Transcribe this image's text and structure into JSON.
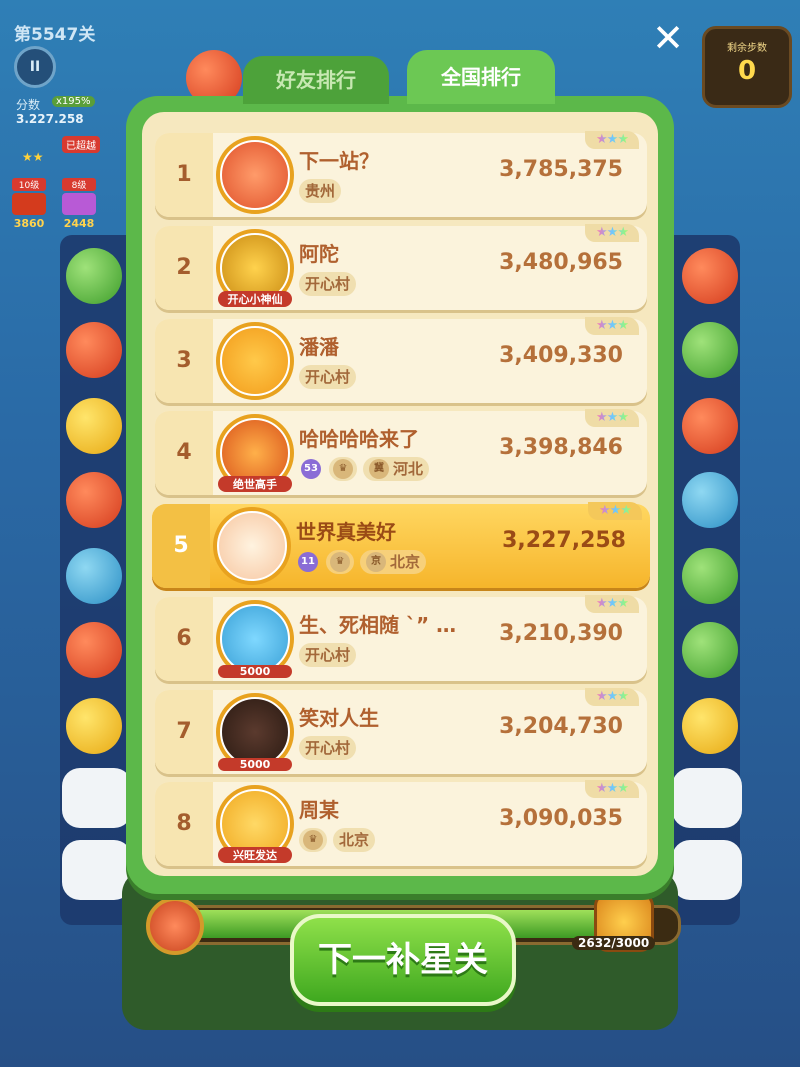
{
  "hud": {
    "level": "第5547关",
    "pause_icon": "pause-icon",
    "score_label": "分数",
    "score_multiplier": "x195%",
    "score_value": "3.227.258",
    "stars": "★★",
    "passed_badge": "已超越",
    "box1_label": "10级",
    "box1_value": "3860",
    "box2_label": "8级",
    "box2_value": "2448",
    "close_icon": "close-icon",
    "steps_label": "剩余步数",
    "steps_value": "0",
    "progress_value": "2632/3000",
    "progress_fraction": 0.877
  },
  "tabs": {
    "friends": "好友排行",
    "national": "全国排行"
  },
  "leaderboard": [
    {
      "rank": "1",
      "name": "下一站？",
      "tags": [
        "贵州"
      ],
      "score": "3,785,375",
      "stars": "★★★",
      "avatar": "fox-avatar"
    },
    {
      "rank": "2",
      "name": "阿陀",
      "tags": [
        "开心村"
      ],
      "score": "3,480,965",
      "avatar_text": "开心小神仙",
      "stars": "★★★",
      "avatar": "monk-avatar"
    },
    {
      "rank": "3",
      "name": "潘潘",
      "tags": [
        "开心村"
      ],
      "score": "3,409,330",
      "stars": "★★★",
      "avatar": "sun-avatar"
    },
    {
      "rank": "4",
      "name": "哈哈哈哈来了",
      "badge": "53",
      "location": "河北",
      "loc_icon": "冀",
      "score": "3,398,846",
      "avatar_text": "绝世高手",
      "stars": "★★★",
      "avatar": "warrior-avatar"
    },
    {
      "rank": "5",
      "name": "世界真美好",
      "badge": "11",
      "location": "北京",
      "loc_icon": "京",
      "score": "3,227,258",
      "stars": "★★★",
      "avatar": "chick-avatar"
    },
    {
      "rank": "6",
      "name": "生、死相随 ˋ” …",
      "tags": [
        "开心村"
      ],
      "score": "3,210,390",
      "avatar_text": "5000",
      "stars": "★★★",
      "avatar": "bird-avatar"
    },
    {
      "rank": "7",
      "name": "笑对人生",
      "tags": [
        "开心村"
      ],
      "score": "3,204,730",
      "avatar_text": "5000",
      "stars": "★★★",
      "avatar": "photo-avatar"
    },
    {
      "rank": "8",
      "name": "周某",
      "location": "北京",
      "score": "3,090,035",
      "avatar_text": "兴旺发达",
      "stars": "★★★",
      "avatar": "duck-avatar"
    }
  ],
  "next_button": "下一补星关",
  "colors": {
    "modal_green": "#5cb84a",
    "panel_cream": "#f6e8bf",
    "highlight_gold": "#f6b52b",
    "text_brown": "#b0602e",
    "button_green": "#3fa81f"
  }
}
